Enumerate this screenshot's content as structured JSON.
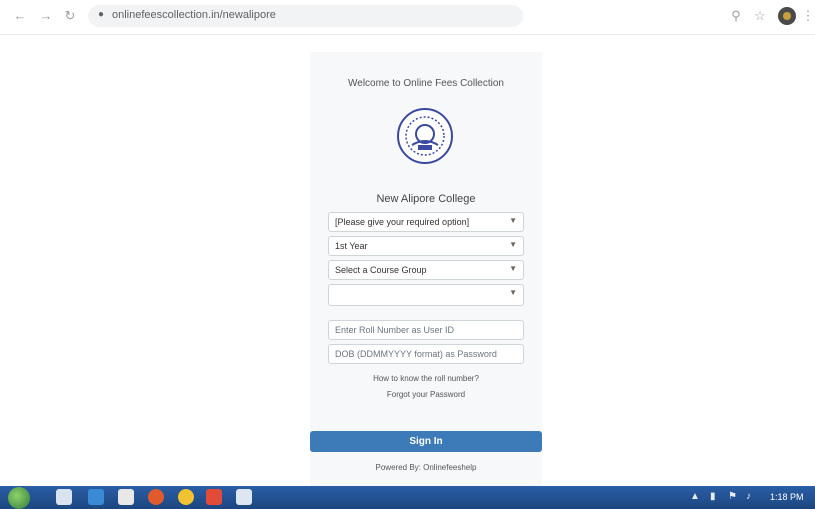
{
  "browser": {
    "url": "onlinefeescollection.in/newalipore",
    "back_icon": "back-arrow-icon",
    "forward_icon": "forward-arrow-icon",
    "reload_icon": "reload-icon"
  },
  "login": {
    "welcome": "Welcome to Online Fees Collection",
    "college_name": "New Alipore College",
    "select_course_type": "[Please give your required option]",
    "select_year": "1st Year",
    "select_course_group": "Select a Course Group",
    "select_extra": "",
    "user_id_placeholder": "Enter Roll Number as User ID",
    "password_placeholder": "DOB (DDMMYYYY format) as Password",
    "forgot_link": "How to know the roll number?",
    "reset_link": "Forgot your Password",
    "signin_label": "Sign In",
    "powered_by": "Powered By: Onlinefeeshelp"
  },
  "taskbar": {
    "clock": "1:18 PM"
  },
  "colors": {
    "accent": "#3d7ab8",
    "taskbar": "#2b5ea6"
  }
}
